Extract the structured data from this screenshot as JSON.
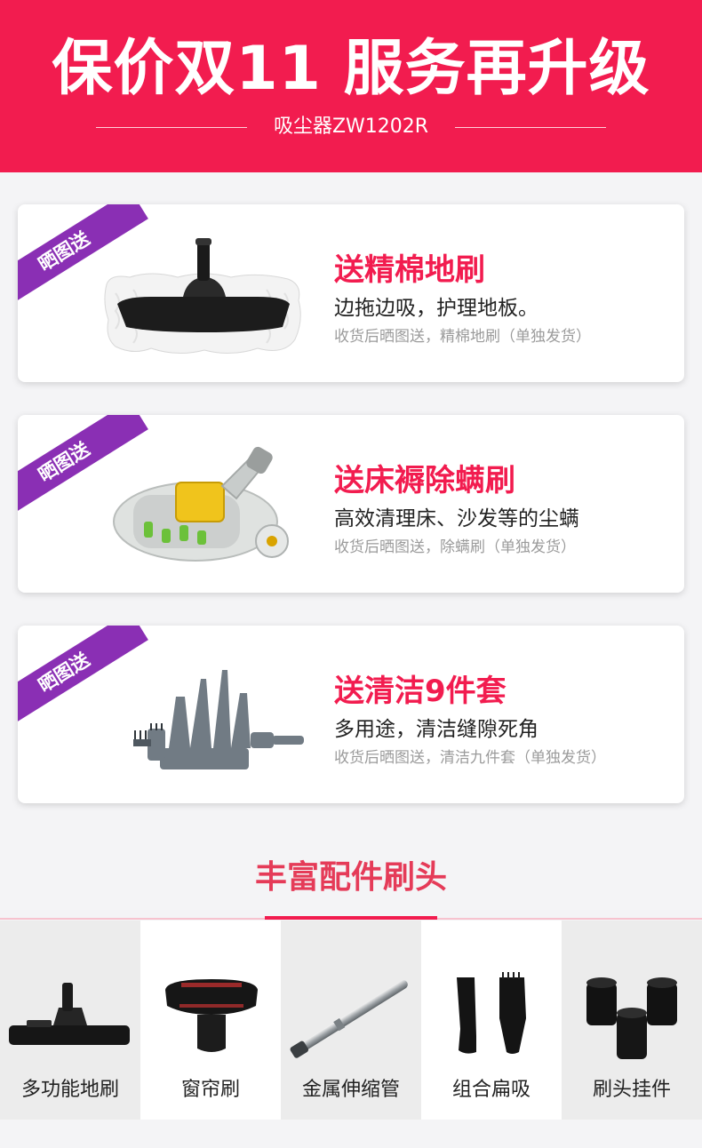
{
  "header": {
    "title": "保价双11 服务再升级",
    "subtitle": "吸尘器ZW1202R"
  },
  "gifts": [
    {
      "ribbon": "晒图送",
      "title": "送精棉地刷",
      "desc": "边拖边吸，护理地板。",
      "note": "收货后晒图送，精棉地刷（单独发货）"
    },
    {
      "ribbon": "晒图送",
      "title": "送床褥除螨刷",
      "desc": "高效清理床、沙发等的尘螨",
      "note": "收货后晒图送，除螨刷（单独发货）"
    },
    {
      "ribbon": "晒图送",
      "title": "送清洁9件套",
      "desc": "多用途，清洁缝隙死角",
      "note": "收货后晒图送，清洁九件套（单独发货）"
    }
  ],
  "accessories": {
    "title": "丰富配件刷头",
    "items": [
      {
        "label": "多功能地刷"
      },
      {
        "label": "窗帘刷"
      },
      {
        "label": "金属伸缩管"
      },
      {
        "label": "组合扁吸"
      },
      {
        "label": "刷头挂件"
      }
    ]
  },
  "colors": {
    "brand_red": "#f21c4f",
    "ribbon_purple": "#8a2fb4",
    "note_gray": "#9b9b9b"
  }
}
